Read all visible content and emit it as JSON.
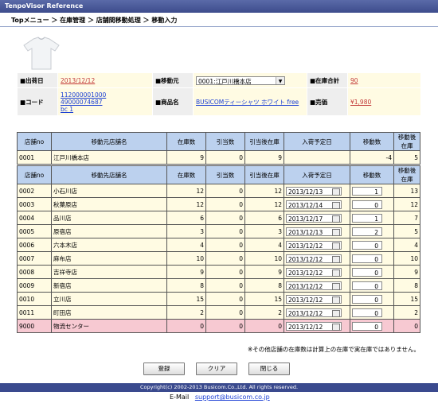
{
  "app": {
    "title": "TenpoVisor Reference"
  },
  "breadcrumb": "Topメニュー ＞ 在庫管理 ＞ 店舗間移動処理 ＞ 移動入力",
  "info": {
    "ship_date_label": "■出荷日",
    "ship_date": "2013/12/12",
    "from_label": "■移動元",
    "from_value": "0001:江戸川橋本店",
    "stock_total_label": "■在庫合計",
    "stock_total": "90",
    "code_label": "■コード",
    "code_lines": [
      "112000001000",
      "49000074687",
      "bc 1"
    ],
    "product_label": "■商品名",
    "product_name": "BUSICOMティーシャツ ホワイト free",
    "price_label": "■売価",
    "price": "¥1,980"
  },
  "source_table": {
    "headers": [
      "店舗no",
      "移動元店舗名",
      "在庫数",
      "引当数",
      "引当後在庫",
      "入荷予定日",
      "移動数",
      "移動後在庫"
    ],
    "row": [
      "0001",
      "江戸川橋本店",
      "9",
      "0",
      "9",
      "",
      "-4",
      "5"
    ]
  },
  "dest_table": {
    "headers": [
      "店舗no",
      "移動先店舗名",
      "在庫数",
      "引当数",
      "引当後在庫",
      "入荷予定日",
      "移動数",
      "移動後在庫"
    ],
    "rows": [
      [
        "0002",
        "小石川店",
        "12",
        "0",
        "12",
        "2013/12/13",
        "1",
        "13"
      ],
      [
        "0003",
        "秋葉原店",
        "12",
        "0",
        "12",
        "2013/12/14",
        "0",
        "12"
      ],
      [
        "0004",
        "品川店",
        "6",
        "0",
        "6",
        "2013/12/17",
        "1",
        "7"
      ],
      [
        "0005",
        "原宿店",
        "3",
        "0",
        "3",
        "2013/12/13",
        "2",
        "5"
      ],
      [
        "0006",
        "六本木店",
        "4",
        "0",
        "4",
        "2013/12/12",
        "0",
        "4"
      ],
      [
        "0007",
        "麻布店",
        "10",
        "0",
        "10",
        "2013/12/12",
        "0",
        "10"
      ],
      [
        "0008",
        "吉祥寺店",
        "9",
        "0",
        "9",
        "2013/12/12",
        "0",
        "9"
      ],
      [
        "0009",
        "新宿店",
        "8",
        "0",
        "8",
        "2013/12/12",
        "0",
        "8"
      ],
      [
        "0010",
        "立川店",
        "15",
        "0",
        "15",
        "2013/12/12",
        "0",
        "15"
      ],
      [
        "0011",
        "町田店",
        "2",
        "0",
        "2",
        "2013/12/12",
        "0",
        "2"
      ],
      [
        "9000",
        "物流センター",
        "0",
        "0",
        "0",
        "2013/12/12",
        "0",
        "0"
      ]
    ]
  },
  "note": "※その他店舗の在庫数は計算上の在庫で実在庫ではありません。",
  "buttons": {
    "register": "登録",
    "clear": "クリア",
    "close": "閉じる"
  },
  "footer": {
    "copyright": "Copyright(c) 2002-2013 Busicom.Co.,Ltd. All rights reserved.",
    "email_label": "E-Mail",
    "email": "support@busicom.co.jp"
  }
}
